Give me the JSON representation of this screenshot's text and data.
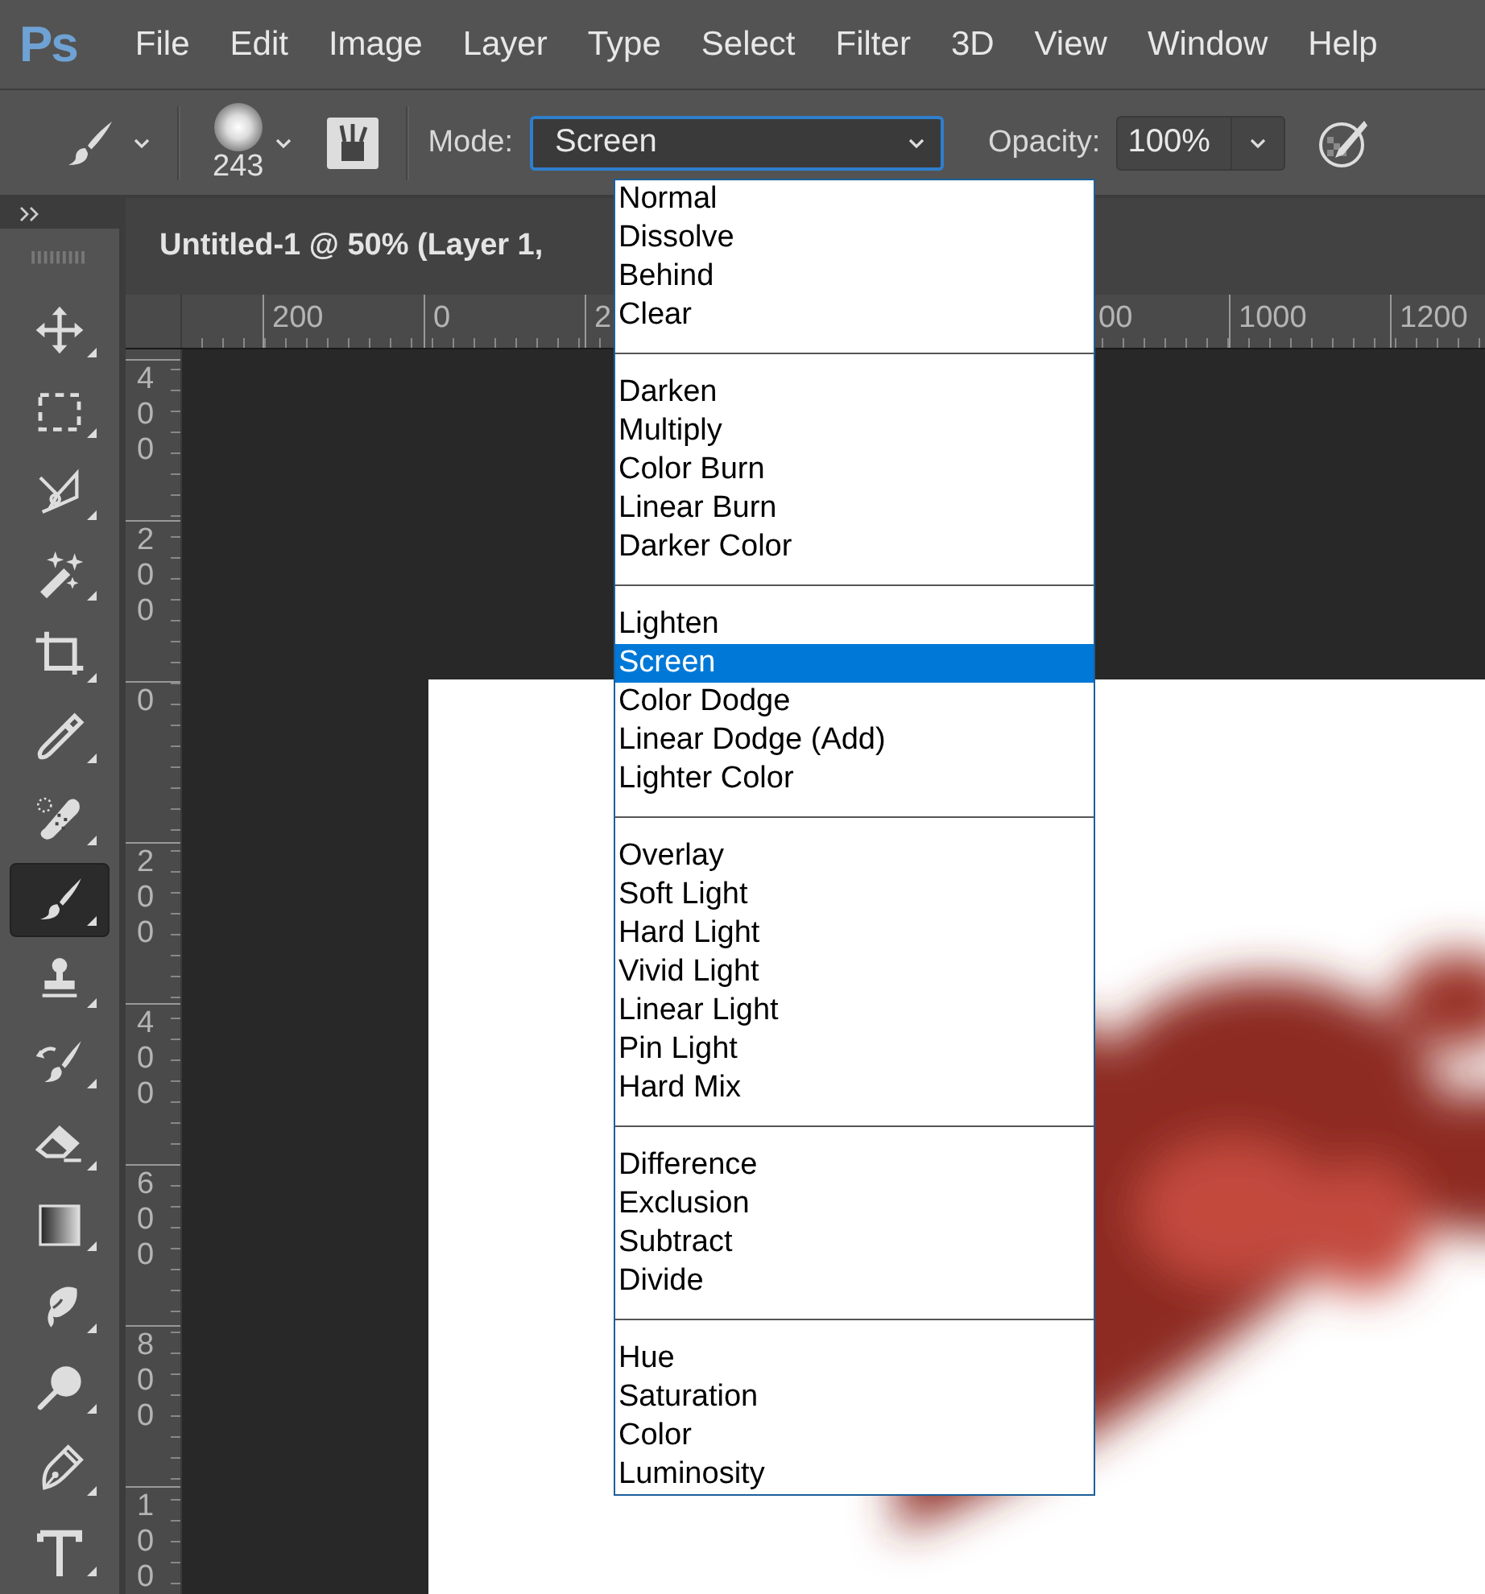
{
  "app": {
    "logo": "Ps"
  },
  "menu": [
    "File",
    "Edit",
    "Image",
    "Layer",
    "Type",
    "Select",
    "Filter",
    "3D",
    "View",
    "Window",
    "Help"
  ],
  "options_bar": {
    "brush_size": "243",
    "mode_label": "Mode:",
    "opacity_label": "Opacity:",
    "opacity_value": "100%"
  },
  "mode_dropdown": {
    "value": "Screen",
    "expanded": true,
    "groups": [
      {
        "items": [
          {
            "label": "Normal",
            "selected": false
          },
          {
            "label": "Dissolve",
            "selected": false
          },
          {
            "label": "Behind",
            "selected": false
          },
          {
            "label": "Clear",
            "selected": false
          }
        ]
      },
      {
        "items": [
          {
            "label": "Darken",
            "selected": false
          },
          {
            "label": "Multiply",
            "selected": false
          },
          {
            "label": "Color Burn",
            "selected": false
          },
          {
            "label": "Linear Burn",
            "selected": false
          },
          {
            "label": "Darker Color",
            "selected": false
          }
        ]
      },
      {
        "items": [
          {
            "label": "Lighten",
            "selected": false
          },
          {
            "label": "Screen",
            "selected": true
          },
          {
            "label": "Color Dodge",
            "selected": false
          },
          {
            "label": "Linear Dodge (Add)",
            "selected": false
          },
          {
            "label": "Lighter Color",
            "selected": false
          }
        ]
      },
      {
        "items": [
          {
            "label": "Overlay",
            "selected": false
          },
          {
            "label": "Soft Light",
            "selected": false
          },
          {
            "label": "Hard Light",
            "selected": false
          },
          {
            "label": "Vivid Light",
            "selected": false
          },
          {
            "label": "Linear Light",
            "selected": false
          },
          {
            "label": "Pin Light",
            "selected": false
          },
          {
            "label": "Hard Mix",
            "selected": false
          }
        ]
      },
      {
        "items": [
          {
            "label": "Difference",
            "selected": false
          },
          {
            "label": "Exclusion",
            "selected": false
          },
          {
            "label": "Subtract",
            "selected": false
          },
          {
            "label": "Divide",
            "selected": false
          }
        ]
      },
      {
        "items": [
          {
            "label": "Hue",
            "selected": false
          },
          {
            "label": "Saturation",
            "selected": false
          },
          {
            "label": "Color",
            "selected": false
          },
          {
            "label": "Luminosity",
            "selected": false
          }
        ]
      }
    ]
  },
  "tools": [
    {
      "kind": "move",
      "selected": false
    },
    {
      "kind": "marquee",
      "selected": false
    },
    {
      "kind": "lasso",
      "selected": false
    },
    {
      "kind": "wand",
      "selected": false
    },
    {
      "kind": "crop",
      "selected": false
    },
    {
      "kind": "eyedropper",
      "selected": false
    },
    {
      "kind": "healing",
      "selected": false
    },
    {
      "kind": "brush",
      "selected": true
    },
    {
      "kind": "stamp",
      "selected": false
    },
    {
      "kind": "history",
      "selected": false
    },
    {
      "kind": "eraser",
      "selected": false
    },
    {
      "kind": "gradient",
      "selected": false
    },
    {
      "kind": "smudge",
      "selected": false
    },
    {
      "kind": "dodge",
      "selected": false
    },
    {
      "kind": "pen",
      "selected": false
    },
    {
      "kind": "type",
      "selected": false
    }
  ],
  "document": {
    "tab_title": "Untitled-1 @ 50% (Layer 1,",
    "h_ruler": [
      "200",
      "0",
      "2",
      "00",
      "1000",
      "1200"
    ],
    "v_ruler": [
      "400",
      "200",
      "0",
      "200",
      "400",
      "600",
      "800",
      "100"
    ]
  }
}
